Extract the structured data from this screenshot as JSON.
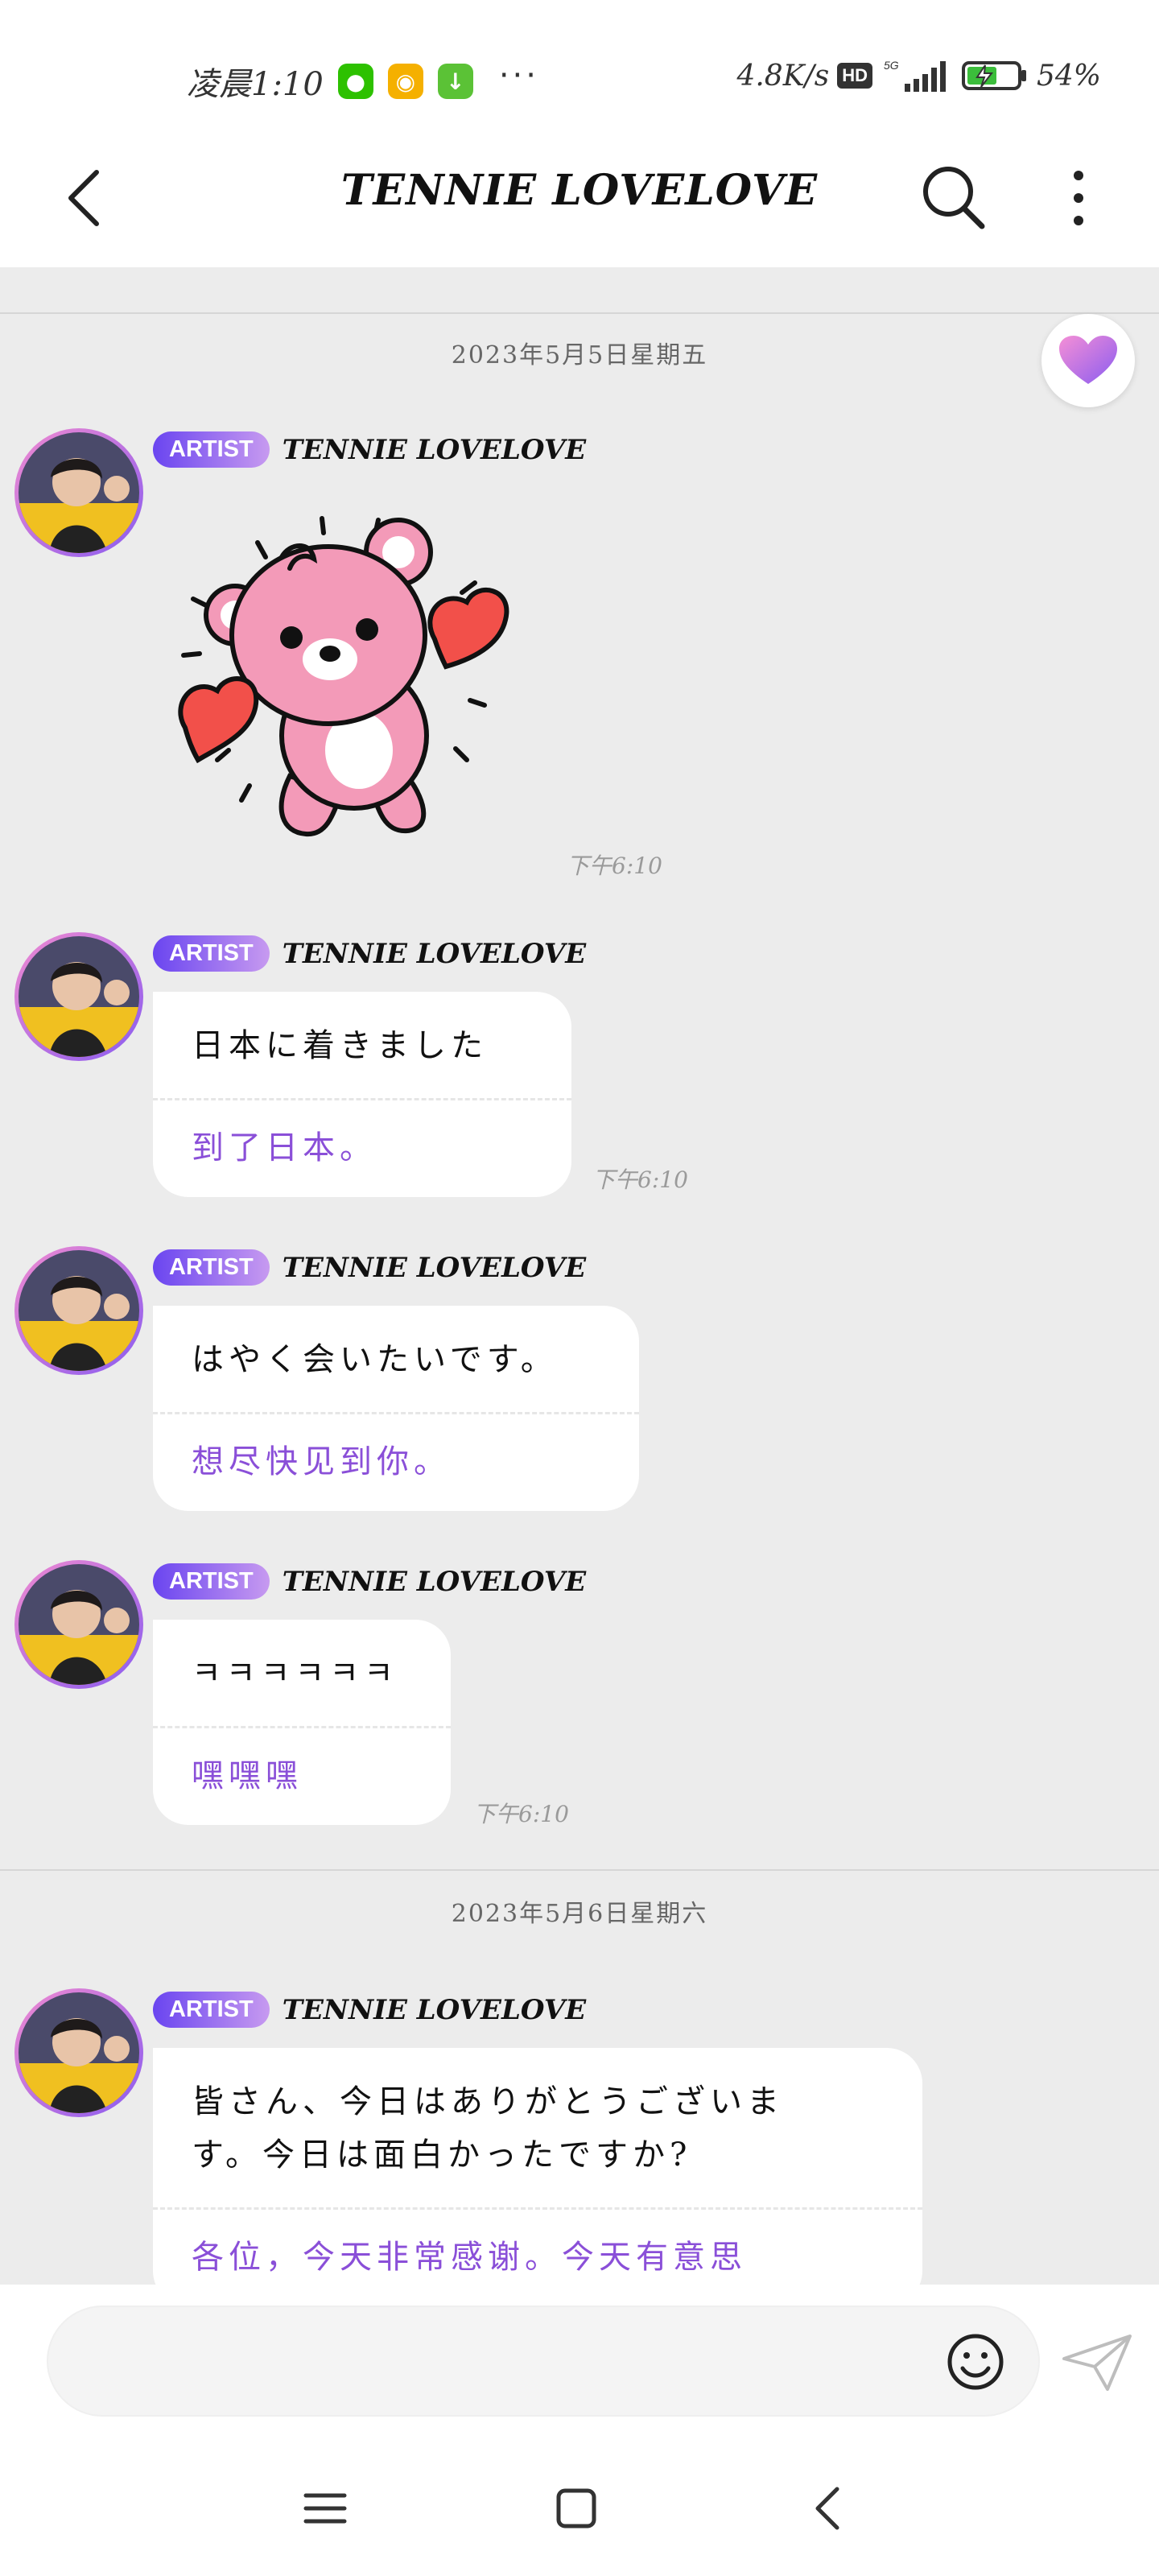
{
  "status_bar": {
    "time": "凌晨1:10",
    "apps": [
      "wechat-icon",
      "weibo-icon",
      "download-icon"
    ],
    "more": "···",
    "speed": "4.8K/s",
    "hd": "HD",
    "network": "5G",
    "battery": "54%"
  },
  "header": {
    "title": "TENNIE LOVELOVE"
  },
  "chat": {
    "dates": [
      "2023年5月5日星期五",
      "2023年5月6日星期六"
    ],
    "messages": [
      {
        "badge": "ARTIST",
        "sender": "TENNIE LOVELOVE",
        "type": "sticker",
        "sticker": "pink-bear-hearts",
        "time": "下午6:10"
      },
      {
        "badge": "ARTIST",
        "sender": "TENNIE LOVELOVE",
        "original": "日本に着きました",
        "translation": "到了日本。",
        "time": "下午6:10"
      },
      {
        "badge": "ARTIST",
        "sender": "TENNIE LOVELOVE",
        "original": "はやく会いたいです。",
        "translation": "想尽快见到你。"
      },
      {
        "badge": "ARTIST",
        "sender": "TENNIE LOVELOVE",
        "original": "ㅋㅋㅋㅋㅋㅋ",
        "translation": "嘿嘿嘿",
        "time": "下午6:10"
      },
      {
        "badge": "ARTIST",
        "sender": "TENNIE LOVELOVE",
        "original_line1": "皆さん、今日はありがとうございま",
        "original_line2": "す。今日は面白かったですか?",
        "translation": "各位，今天非常感谢。今天有意思"
      }
    ]
  },
  "colors": {
    "accent": "#8a4fd8",
    "badge_start": "#6a45f0",
    "badge_end": "#c79af0",
    "chat_bg": "#ececec"
  }
}
